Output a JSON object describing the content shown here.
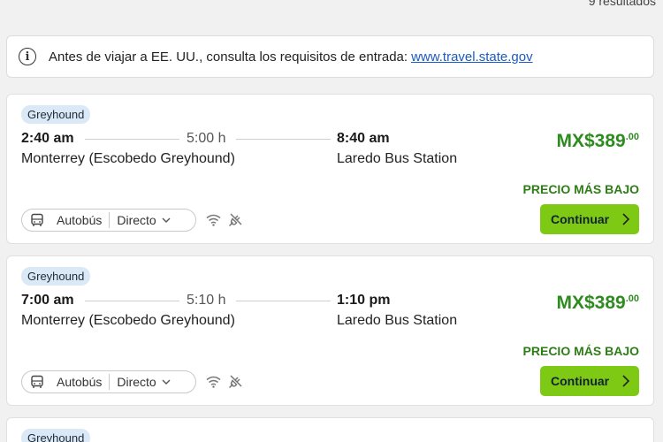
{
  "header": {
    "results_count": "9 resultados"
  },
  "notice": {
    "text": "Antes de viajar a EE. UU., consulta los requisitos de entrada:",
    "link": "www.travel.state.gov"
  },
  "results": [
    {
      "operator": "Greyhound",
      "departure_time": "2:40 am",
      "duration": "5:00 h",
      "arrival_time": "8:40 am",
      "departure_station": "Monterrey (Escobedo Greyhound)",
      "arrival_station": "Laredo Bus Station",
      "price_main": "MX$389",
      "price_cents": ".00",
      "price_label": "PRECIO MÁS BAJO",
      "vehicle": "Autobús",
      "route_type": "Directo",
      "button": "Continuar"
    },
    {
      "operator": "Greyhound",
      "departure_time": "7:00 am",
      "duration": "5:10 h",
      "arrival_time": "1:10 pm",
      "departure_station": "Monterrey (Escobedo Greyhound)",
      "arrival_station": "Laredo Bus Station",
      "price_main": "MX$389",
      "price_cents": ".00",
      "price_label": "PRECIO MÁS BAJO",
      "vehicle": "Autobús",
      "route_type": "Directo",
      "button": "Continuar"
    },
    {
      "operator": "Greyhound"
    }
  ],
  "icons": {
    "info": "info-circle-icon",
    "bus": "bus-icon",
    "chevron": "chevron-down-icon",
    "wifi": "wifi-icon",
    "plug": "plug-icon",
    "arrow": "chevron-right-icon"
  },
  "colors": {
    "price": "#2e8b1f",
    "button": "#7dc914",
    "badge": "#dbe9f7",
    "link": "#1a5bc4"
  }
}
